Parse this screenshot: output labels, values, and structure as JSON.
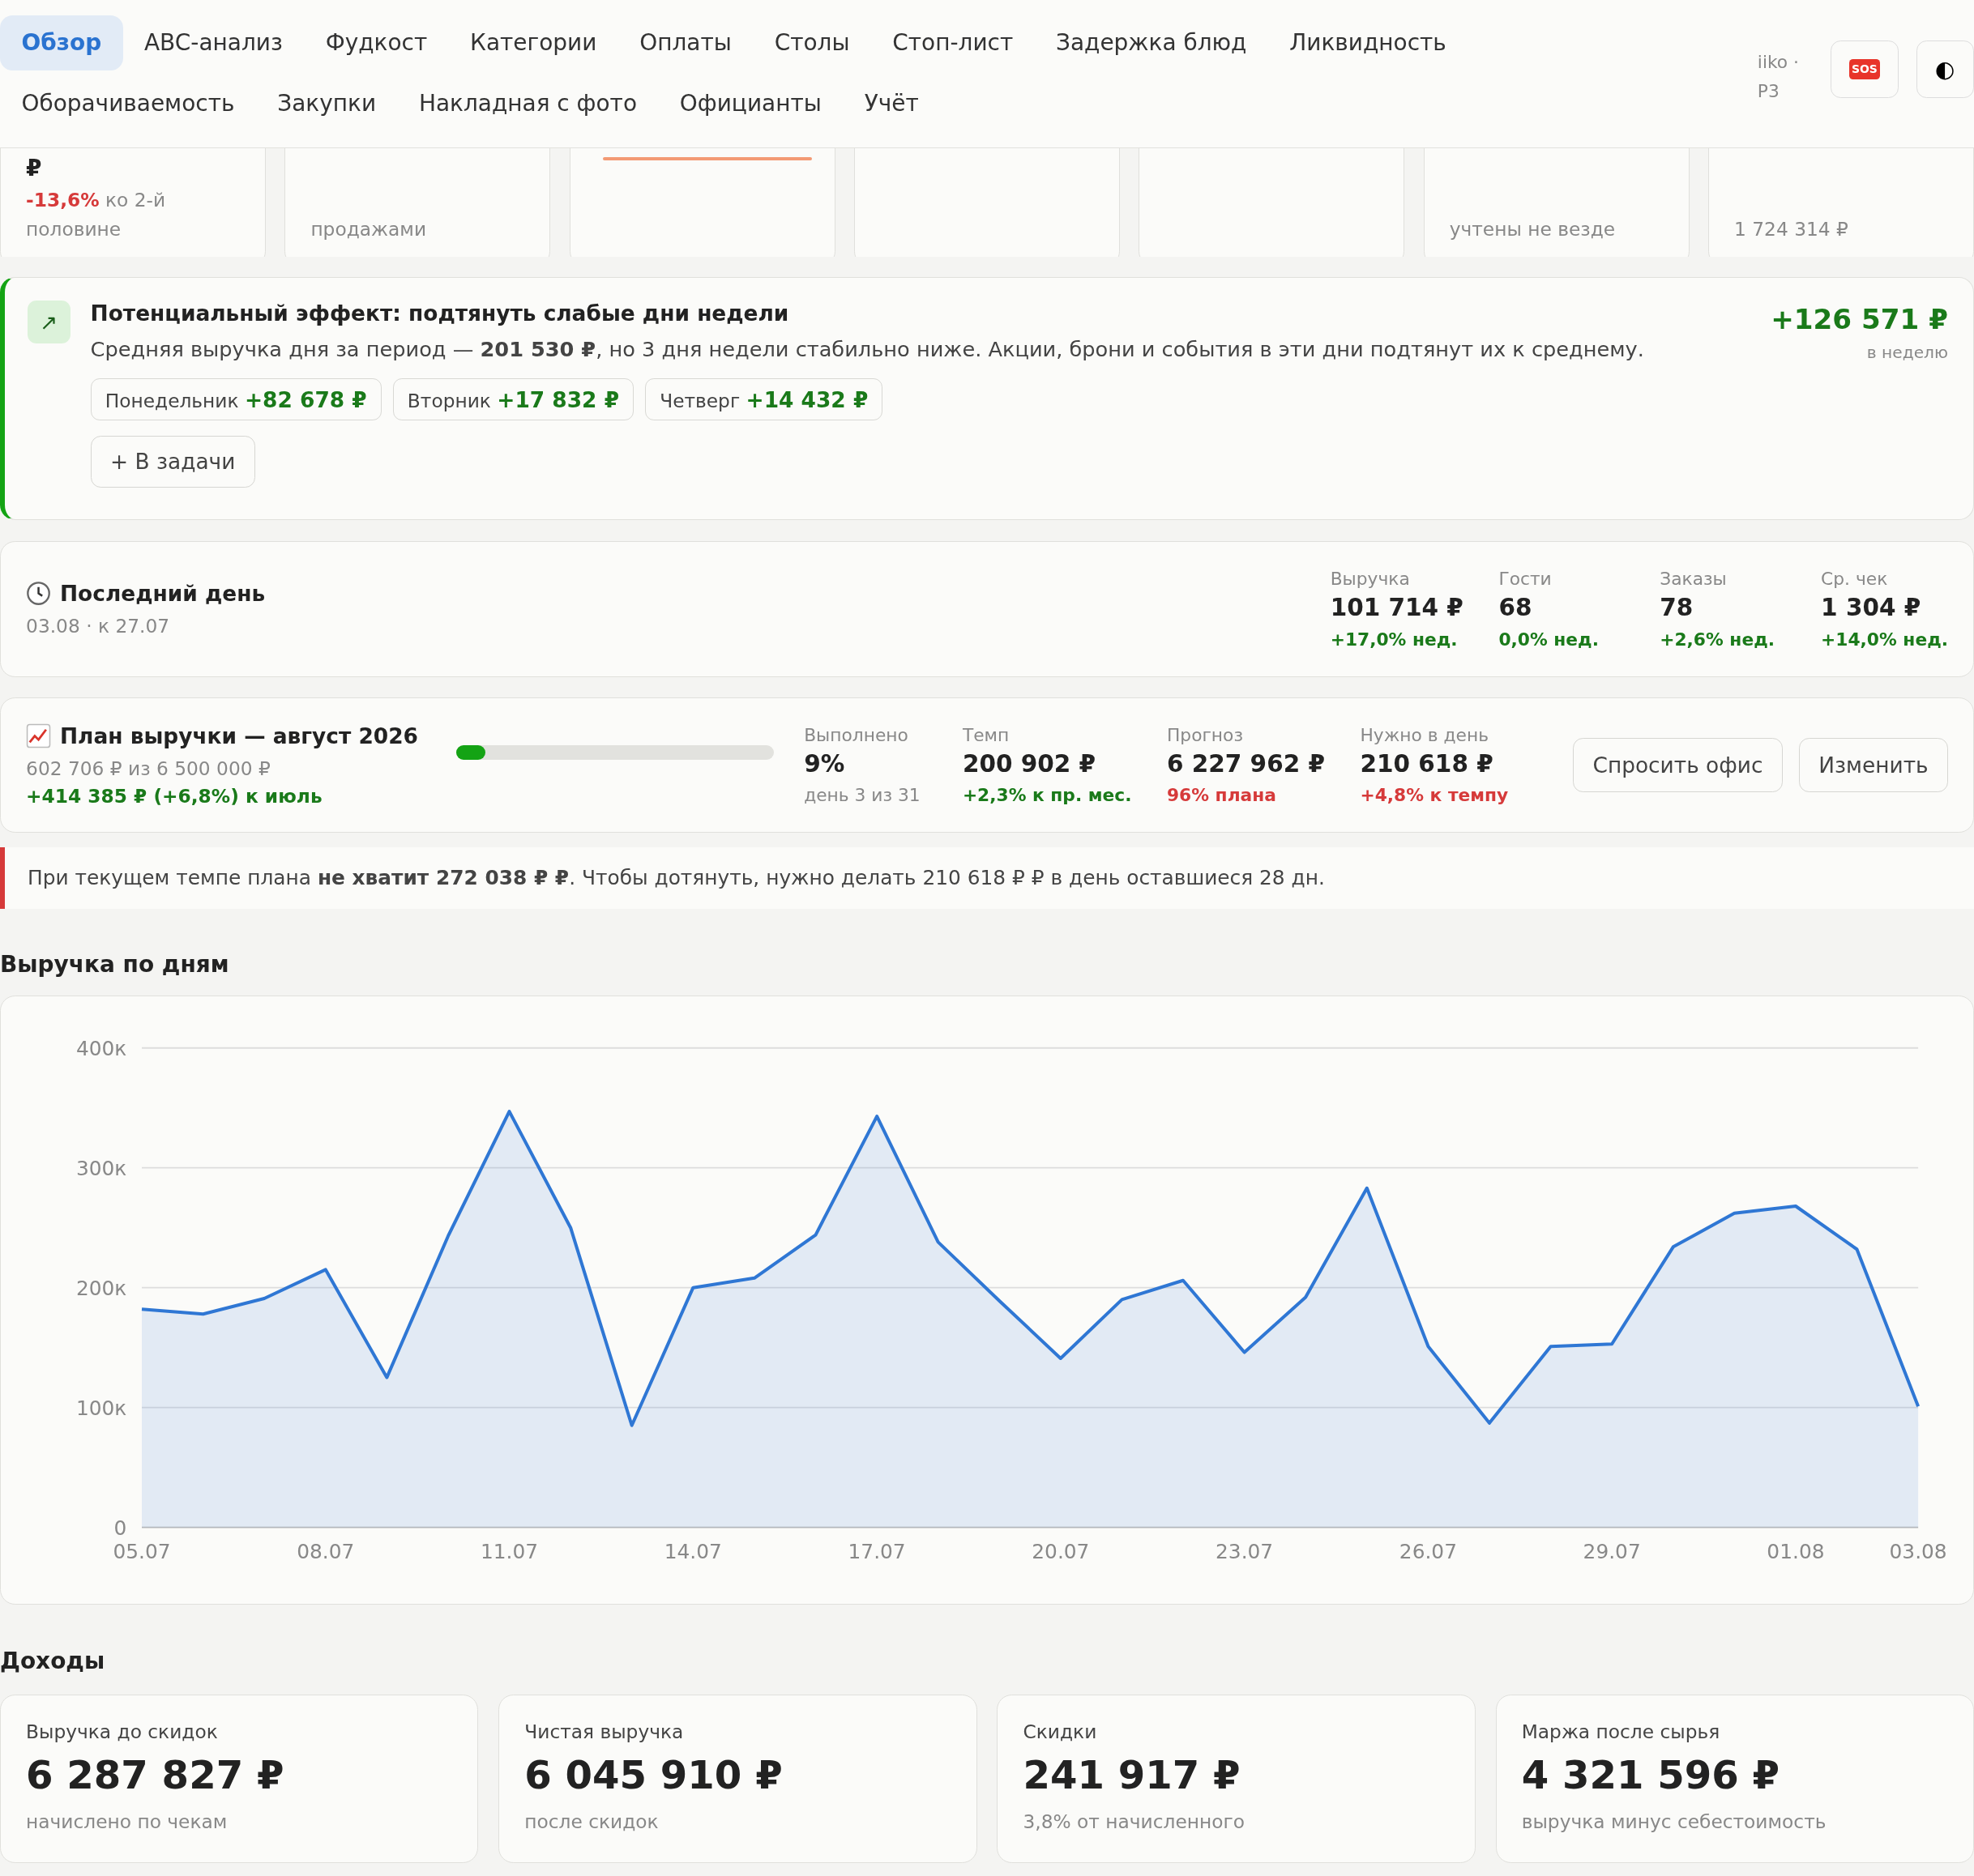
{
  "nav": {
    "tabs": [
      {
        "label": "Обзор",
        "selected": true
      },
      {
        "label": "ABC-анализ",
        "selected": false
      },
      {
        "label": "Фудкост",
        "selected": false
      },
      {
        "label": "Категории",
        "selected": false
      },
      {
        "label": "Оплаты",
        "selected": false
      },
      {
        "label": "Столы",
        "selected": false
      },
      {
        "label": "Стоп-лист",
        "selected": false
      },
      {
        "label": "Задержка блюд",
        "selected": false
      },
      {
        "label": "Ликвидность",
        "selected": false
      },
      {
        "label": "Оборачиваемость",
        "selected": false
      },
      {
        "label": "Закупки",
        "selected": false
      },
      {
        "label": "Накладная с фото",
        "selected": false
      },
      {
        "label": "Официанты",
        "selected": false
      },
      {
        "label": "Учёт",
        "selected": false
      }
    ],
    "source": "iiko · Р3",
    "sos_button": "SOS",
    "theme_button": "◐"
  },
  "top_cards": [
    {
      "kind": "stat",
      "value": "₽",
      "delta": "-13,6%",
      "note": "ко 2-й половине"
    },
    {
      "kind": "stat",
      "note": "продажами"
    },
    {
      "kind": "stat",
      "color": "#f39a74"
    },
    {
      "kind": "stat"
    },
    {
      "kind": "stat"
    },
    {
      "kind": "stat",
      "note": "учтены не везде"
    },
    {
      "kind": "stat",
      "note": "1 724 314 ₽"
    }
  ],
  "effect": {
    "icon": "↗",
    "title": "Потенциальный эффект: подтянуть слабые дни недели",
    "text": "Средняя выручка дня за период — **201 530 ₽**, но 3 дня недели стабильно ниже. Акции, брони и события в эти дни подтянут их к среднему.",
    "total": "+126 571 ₽",
    "total_note": "в неделю",
    "days": [
      {
        "day": "Понедельник",
        "gain": "+82 678 ₽"
      },
      {
        "day": "Вторник",
        "gain": "+17 832 ₽"
      },
      {
        "day": "Четверг",
        "gain": "+14 432 ₽"
      }
    ],
    "button": "+ В задачи"
  },
  "last_day": {
    "title": "Последний день",
    "subtitle": "03.08 · к 27.07",
    "metrics": [
      {
        "label": "Выручка",
        "value": "101 714 ₽",
        "delta": "+17,0% нед.",
        "kind": "good"
      },
      {
        "label": "Гости",
        "value": "68",
        "delta": "0,0% нед.",
        "kind": "good"
      },
      {
        "label": "Заказы",
        "value": "78",
        "delta": "+2,6% нед.",
        "kind": "good"
      },
      {
        "label": "Ср. чек",
        "value": "1 304 ₽",
        "delta": "+14,0% нед.",
        "kind": "good"
      }
    ]
  },
  "plan": {
    "title": "План выручки — август 2026",
    "subtitle": "602 706 ₽ из 6 500 000 ₽",
    "delta": "+414 385 ₽ (+6,8%) к июль",
    "level": 0.09,
    "metrics": [
      {
        "label": "Выполнено",
        "value": "9%",
        "note": "день 3 из 31",
        "kind": "muted"
      },
      {
        "label": "Темп",
        "value": "200 902 ₽",
        "note": "+2,3% к пр. мес.",
        "kind": "good"
      },
      {
        "label": "Прогноз",
        "value": "6 227 962 ₽",
        "note": "96% плана",
        "kind": "bad"
      },
      {
        "label": "Нужно в день",
        "value": "210 618 ₽",
        "note": "+4,8% к темпу",
        "kind": "bad"
      }
    ],
    "buttons": [
      "Спросить офис",
      "Изменить"
    ]
  },
  "alert": "При текущем темпе плана **не хватит 272 038 ₽ ₽**. Чтобы дотянуть, нужно делать 210 618 ₽ ₽ в день оставшиеся 28 дн.",
  "revenue": {
    "title": "Выручка по дням",
    "chart_data": {
      "type": "area",
      "categories": [
        "05.07",
        null,
        null,
        "08.07",
        null,
        null,
        "11.07",
        null,
        null,
        "14.07",
        null,
        null,
        "17.07",
        null,
        null,
        "20.07",
        null,
        null,
        "23.07",
        null,
        null,
        "26.07",
        null,
        null,
        "29.07",
        null,
        null,
        "01.08",
        null,
        "03.08"
      ],
      "grid": true,
      "series": [
        {
          "color": "#2f77d4",
          "values": [
            182,
            178,
            191,
            215,
            125,
            243,
            347,
            250,
            85,
            200,
            208,
            244,
            343,
            238,
            189,
            141,
            190,
            206,
            146,
            192,
            283,
            151,
            87,
            151,
            153,
            234,
            262,
            268,
            232,
            101
          ]
        }
      ],
      "ylim": [
        0,
        400
      ],
      "yticks": [
        {
          "value": 0,
          "label": "0"
        },
        {
          "value": 100,
          "label": "100к"
        },
        {
          "value": 200,
          "label": "200к"
        },
        {
          "value": 300,
          "label": "300к"
        },
        {
          "value": 400,
          "label": "400к"
        }
      ]
    }
  },
  "income": {
    "title": "Доходы",
    "cards": [
      {
        "label": "Выручка до скидок",
        "value": "6 287 827 ₽",
        "note": "начислено по чекам"
      },
      {
        "label": "Чистая выручка",
        "value": "6 045 910 ₽",
        "note": "после скидок"
      },
      {
        "label": "Скидки",
        "value": "241 917 ₽",
        "note": "3,8% от начисленного"
      },
      {
        "label": "Маржа после сырья",
        "value": "4 321 596 ₽",
        "note": "выручка минус себестоимость"
      }
    ]
  }
}
